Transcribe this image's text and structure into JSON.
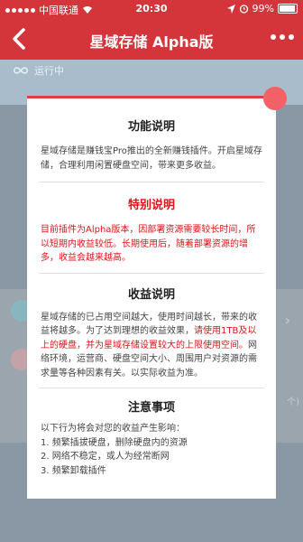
{
  "status_bar": {
    "carrier": "中国联通",
    "time": "20:30",
    "battery": "99%"
  },
  "nav": {
    "title": "星域存储 Alpha版"
  },
  "background": {
    "running_label": "运行中",
    "count_hint": "个)"
  },
  "modal": {
    "sections": [
      {
        "title": "功能说明",
        "text": "星域存储是赚钱宝Pro推出的全新赚钱插件。开启星域存储，合理利用闲置硬盘空间，带来更多收益。"
      },
      {
        "title": "特别说明",
        "text": "目前插件为Alpha版本，因部署资源需要较长时间，所以短期内收益较低。长期使用后，随着部署资源的增多，收益会越来越高。"
      },
      {
        "title": "收益说明",
        "text_part1": "星域存储的已占用空间越大，使用时间越长，带来的收益将越多。为了达到理想的收益效果，",
        "text_red": "请使用1TB及以上的硬盘，并为星域存储设置较大的上限使用空间。",
        "text_part2": "网络环境，运营商、硬盘空间大小、周围用户对资源的需求量等各种因素有关。以实际收益为准。"
      },
      {
        "title": "注意事项",
        "intro": "以下行为将会对您的收益产生影响：",
        "items": [
          "1. 频繁插拔硬盘，删除硬盘内的资源",
          "2. 网络不稳定，或人为经常断网",
          "3. 频繁卸载插件"
        ]
      }
    ]
  },
  "colors": {
    "brand_red": "#d3353b",
    "accent_red": "#e0131a"
  }
}
